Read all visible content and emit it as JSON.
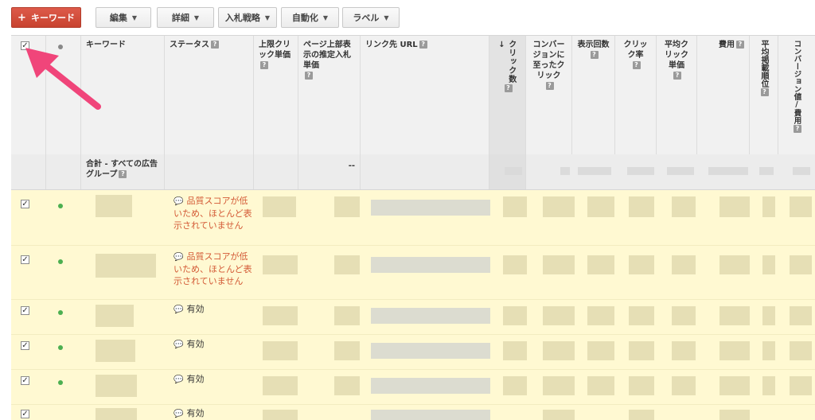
{
  "toolbar": {
    "add_keyword": "キーワード",
    "edit": "編集",
    "details": "詳細",
    "bid_strategy": "入札戦略",
    "automate": "自動化",
    "labels": "ラベル"
  },
  "columns": {
    "keyword": "キーワード",
    "status": "ステータス",
    "max_cpc": "上限クリック単価",
    "first_page_bid": "ページ上部表示の推定入札単価",
    "final_url": "リンク先 URL",
    "clicks": "クリック数",
    "converted_clicks": "コンバージョンに至ったクリック",
    "impressions": "表示回数",
    "ctr": "クリック率",
    "avg_cpc": "平均クリック単価",
    "cost": "費用",
    "avg_pos": "平均掲載順位",
    "conv_value_cost": "コンバージョン値/費用",
    "help": "?",
    "sort_indicator": "↓"
  },
  "total_row": {
    "label": "合計 - すべての広告グループ",
    "first_page_bid": "--"
  },
  "rows": [
    {
      "checked": true,
      "status": "品質スコアが低いため、ほとんど表示されていません",
      "status_type": "warning"
    },
    {
      "checked": true,
      "status": "品質スコアが低いため、ほとんど表示されていません",
      "status_type": "warning"
    },
    {
      "checked": true,
      "status": "有効",
      "status_type": "ok"
    },
    {
      "checked": true,
      "status": "有効",
      "status_type": "ok"
    },
    {
      "checked": true,
      "status": "有効",
      "status_type": "ok"
    },
    {
      "checked": true,
      "status": "有効",
      "status_type": "ok"
    }
  ],
  "colors": {
    "primary_button": "#c8432f",
    "row_highlight": "#fff9d2",
    "warning_text": "#d35a36",
    "enabled_dot": "#4caf50",
    "arrow": "#f0457a"
  }
}
